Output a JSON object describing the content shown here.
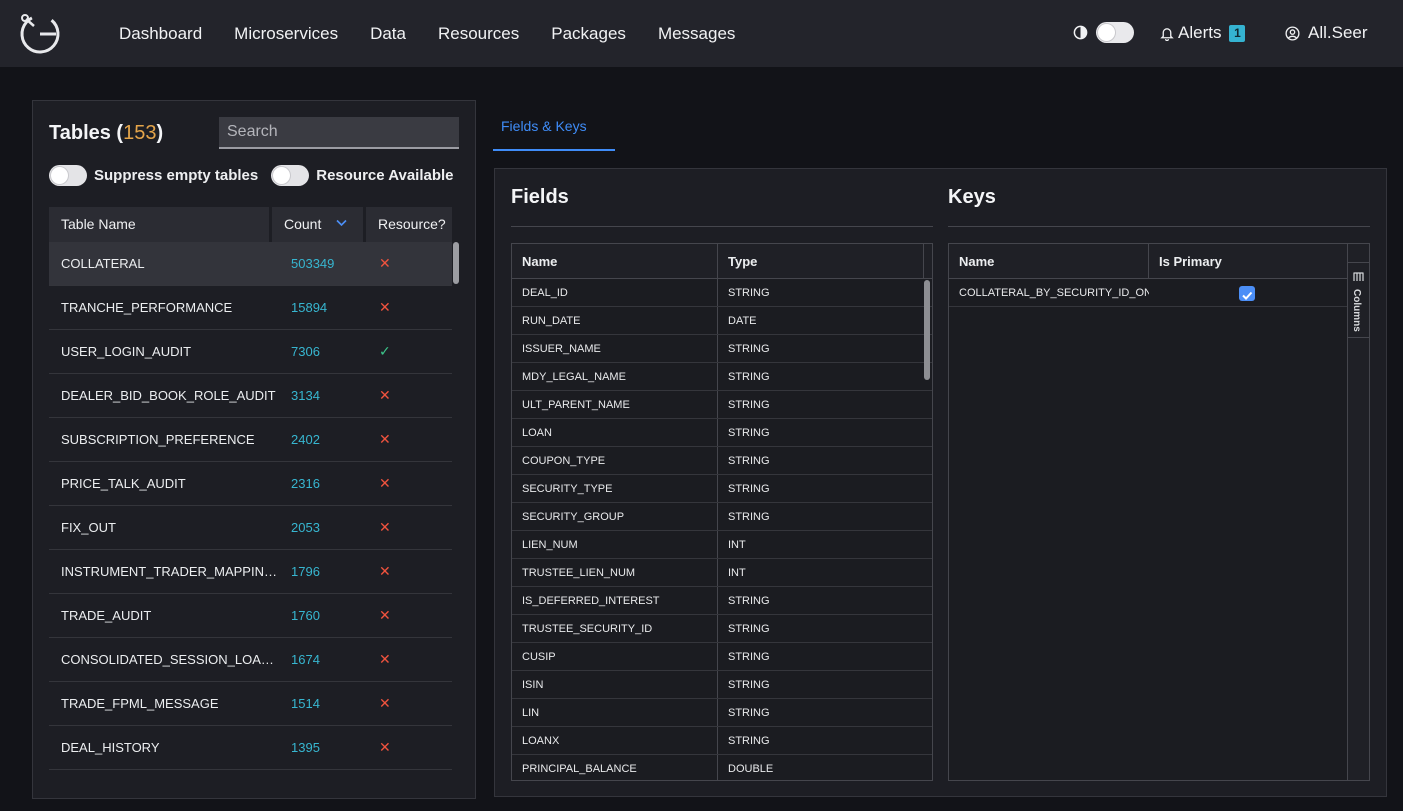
{
  "nav": {
    "items": [
      "Dashboard",
      "Microservices",
      "Data",
      "Resources",
      "Packages",
      "Messages"
    ],
    "alerts_label": "Alerts",
    "alerts_count": "1",
    "user_name": "All.Seer",
    "icons": {
      "logo": "logo-icon",
      "theme": "contrast-icon",
      "alerts": "bell-icon",
      "user": "user-circle-icon"
    }
  },
  "tables": {
    "title": "Tables",
    "count": "153",
    "search_placeholder": "Search",
    "toggle_suppress_label": "Suppress empty tables",
    "toggle_resource_label": "Resource Available",
    "headers": {
      "name": "Table Name",
      "count": "Count",
      "resource": "Resource?"
    },
    "rows": [
      {
        "name": "COLLATERAL",
        "count": "503349",
        "resource": false
      },
      {
        "name": "TRANCHE_PERFORMANCE",
        "count": "15894",
        "resource": false
      },
      {
        "name": "USER_LOGIN_AUDIT",
        "count": "7306",
        "resource": true
      },
      {
        "name": "DEALER_BID_BOOK_ROLE_AUDIT",
        "count": "3134",
        "resource": false
      },
      {
        "name": "SUBSCRIPTION_PREFERENCE",
        "count": "2402",
        "resource": false
      },
      {
        "name": "PRICE_TALK_AUDIT",
        "count": "2316",
        "resource": false
      },
      {
        "name": "FIX_OUT",
        "count": "2053",
        "resource": false
      },
      {
        "name": "INSTRUMENT_TRADER_MAPPING_A...",
        "count": "1796",
        "resource": false
      },
      {
        "name": "TRADE_AUDIT",
        "count": "1760",
        "resource": false
      },
      {
        "name": "CONSOLIDATED_SESSION_LOAN_P...",
        "count": "1674",
        "resource": false
      },
      {
        "name": "TRADE_FPML_MESSAGE",
        "count": "1514",
        "resource": false
      },
      {
        "name": "DEAL_HISTORY",
        "count": "1395",
        "resource": false
      }
    ],
    "colors": {
      "count": "#37b6d0",
      "cross": "#f0533e",
      "check": "#3cc58a",
      "title_count": "#e5a54a"
    }
  },
  "tabs": {
    "fields_keys": "Fields & Keys"
  },
  "fields": {
    "title": "Fields",
    "headers": {
      "name": "Name",
      "type": "Type"
    },
    "rows": [
      {
        "name": "DEAL_ID",
        "type": "STRING"
      },
      {
        "name": "RUN_DATE",
        "type": "DATE"
      },
      {
        "name": "ISSUER_NAME",
        "type": "STRING"
      },
      {
        "name": "MDY_LEGAL_NAME",
        "type": "STRING"
      },
      {
        "name": "ULT_PARENT_NAME",
        "type": "STRING"
      },
      {
        "name": "LOAN",
        "type": "STRING"
      },
      {
        "name": "COUPON_TYPE",
        "type": "STRING"
      },
      {
        "name": "SECURITY_TYPE",
        "type": "STRING"
      },
      {
        "name": "SECURITY_GROUP",
        "type": "STRING"
      },
      {
        "name": "LIEN_NUM",
        "type": "INT"
      },
      {
        "name": "TRUSTEE_LIEN_NUM",
        "type": "INT"
      },
      {
        "name": "IS_DEFERRED_INTEREST",
        "type": "STRING"
      },
      {
        "name": "TRUSTEE_SECURITY_ID",
        "type": "STRING"
      },
      {
        "name": "CUSIP",
        "type": "STRING"
      },
      {
        "name": "ISIN",
        "type": "STRING"
      },
      {
        "name": "LIN",
        "type": "STRING"
      },
      {
        "name": "LOANX",
        "type": "STRING"
      },
      {
        "name": "PRINCIPAL_BALANCE",
        "type": "DOUBLE"
      }
    ]
  },
  "keys": {
    "title": "Keys",
    "headers": {
      "name": "Name",
      "primary": "Is Primary"
    },
    "rows": [
      {
        "name": "COLLATERAL_BY_SECURITY_ID_ONE",
        "primary": true
      }
    ],
    "columns_label": "Columns"
  }
}
